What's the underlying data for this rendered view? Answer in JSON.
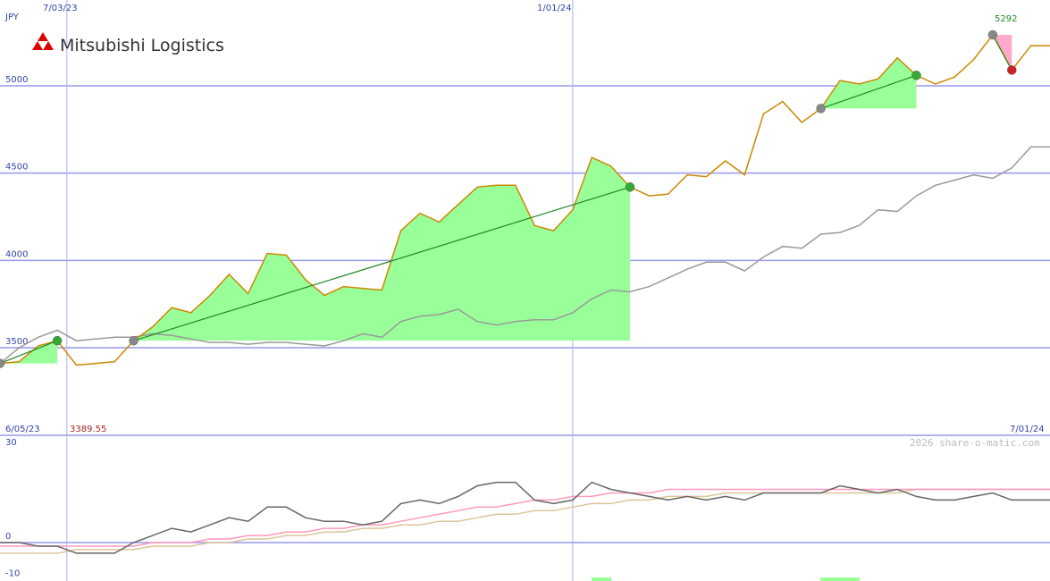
{
  "header": {
    "currency": "JPY",
    "company": "Mitsubishi Logistics",
    "date_top_left": "7/03/23",
    "date_top_mid": "1/01/24",
    "peak_value": "5292"
  },
  "lower_panel": {
    "date_left": "6/05/23",
    "low_value": "3389.55",
    "date_right": "7/01/24",
    "watermark": "2026 share-o-matic.com"
  },
  "colors": {
    "price": "#cc8800",
    "ma": "#999999",
    "trend": "#228822",
    "fill_up": "#99ff99",
    "fill_down": "#ffaacc",
    "grid_h": "#9999ee",
    "grid_v": "#aab4f0",
    "axis_text": "#3344aa",
    "osc": "#666666",
    "osc_pink": "#ff99bb",
    "osc_tan": "#ddc499",
    "brand_red": "#dd0000"
  },
  "chart_data": [
    {
      "type": "line",
      "ylim": [
        3420,
        5500
      ],
      "yticks": [
        3500,
        4000,
        4500,
        5000
      ],
      "x_weeks_from_2023_06_05": [
        0,
        1,
        2,
        3,
        4,
        5,
        6,
        7,
        8,
        9,
        10,
        11,
        12,
        13,
        14,
        15,
        16,
        17,
        18,
        19,
        20,
        21,
        22,
        23,
        24,
        25,
        26,
        27,
        28,
        29,
        30,
        31,
        32,
        33,
        34,
        35,
        36,
        37,
        38,
        39,
        40,
        41,
        42,
        43,
        44,
        45,
        46,
        47,
        48,
        49,
        50,
        51,
        52,
        53,
        54,
        55
      ],
      "series": [
        {
          "values": [
            3410,
            3420,
            3510,
            3540,
            3400,
            3410,
            3420,
            3540,
            3620,
            3730,
            3700,
            3800,
            3920,
            3810,
            4040,
            4030,
            3890,
            3800,
            3850,
            3840,
            3830,
            4170,
            4270,
            4220,
            4320,
            4420,
            4430,
            4430,
            4200,
            4170,
            4290,
            4590,
            4540,
            4420,
            4370,
            4380,
            4490,
            4480,
            4570,
            4490,
            4840,
            4910,
            4790,
            4870,
            5030,
            5010,
            5040,
            5160,
            5060,
            5010,
            5050,
            5150,
            5292,
            5090,
            5230,
            5230
          ],
          "ma": [
            3410,
            3500,
            3560,
            3600,
            3540,
            3550,
            3560,
            3560,
            3580,
            3570,
            3550,
            3530,
            3530,
            3520,
            3530,
            3530,
            3520,
            3510,
            3540,
            3580,
            3560,
            3650,
            3680,
            3690,
            3720,
            3650,
            3630,
            3650,
            3660,
            3660,
            3700,
            3780,
            3830,
            3820,
            3850,
            3900,
            3950,
            3990,
            3990,
            3940,
            4020,
            4080,
            4070,
            4150,
            4160,
            4200,
            4290,
            4280,
            4370,
            4430,
            4460,
            4490,
            4470,
            4530,
            4650,
            4650
          ]
        }
      ],
      "trend_segments": [
        {
          "from": [
            0,
            3410
          ],
          "to": [
            3,
            3540
          ]
        },
        {
          "from": [
            7,
            3540
          ],
          "to": [
            33,
            4420
          ]
        },
        {
          "from": [
            43,
            4870
          ],
          "to": [
            48,
            5060
          ]
        },
        {
          "from": [
            52,
            5292
          ],
          "to": [
            53,
            5090
          ]
        }
      ]
    },
    {
      "type": "line",
      "ylim": [
        -10,
        30
      ],
      "yticks": [
        -10,
        0,
        30
      ],
      "series": [
        {
          "values": [
            0,
            0,
            -1,
            -1,
            -3,
            -3,
            -3,
            0,
            2,
            4,
            3,
            5,
            7,
            6,
            10,
            10,
            7,
            6,
            6,
            5,
            6,
            11,
            12,
            11,
            13,
            16,
            17,
            17,
            12,
            11,
            12,
            17,
            15,
            14,
            13,
            12,
            13,
            12,
            13,
            12,
            14,
            14,
            14,
            14,
            16,
            15,
            14,
            15,
            13,
            12,
            12,
            13,
            14,
            12,
            12,
            12
          ]
        },
        {
          "values": [
            -1,
            -1,
            -1,
            -1,
            -1,
            -1,
            -1,
            -1,
            0,
            0,
            0,
            1,
            1,
            2,
            2,
            3,
            3,
            4,
            4,
            5,
            5,
            6,
            7,
            8,
            9,
            10,
            10,
            11,
            12,
            12,
            13,
            13,
            14,
            14,
            14,
            15,
            15,
            15,
            15,
            15,
            15,
            15,
            15,
            15,
            15,
            15,
            15,
            15,
            15,
            15,
            15,
            15,
            15,
            15,
            15,
            15
          ]
        },
        {
          "values": [
            -3,
            -3,
            -3,
            -3,
            -2,
            -2,
            -2,
            -2,
            -1,
            -1,
            -1,
            0,
            0,
            1,
            1,
            2,
            2,
            3,
            3,
            4,
            4,
            5,
            5,
            6,
            6,
            7,
            8,
            8,
            9,
            9,
            10,
            11,
            11,
            12,
            12,
            13,
            13,
            13,
            14,
            14,
            14,
            14,
            14,
            14,
            14,
            14,
            14,
            14,
            15,
            15,
            15,
            15,
            15,
            15,
            15,
            15
          ]
        }
      ]
    }
  ]
}
